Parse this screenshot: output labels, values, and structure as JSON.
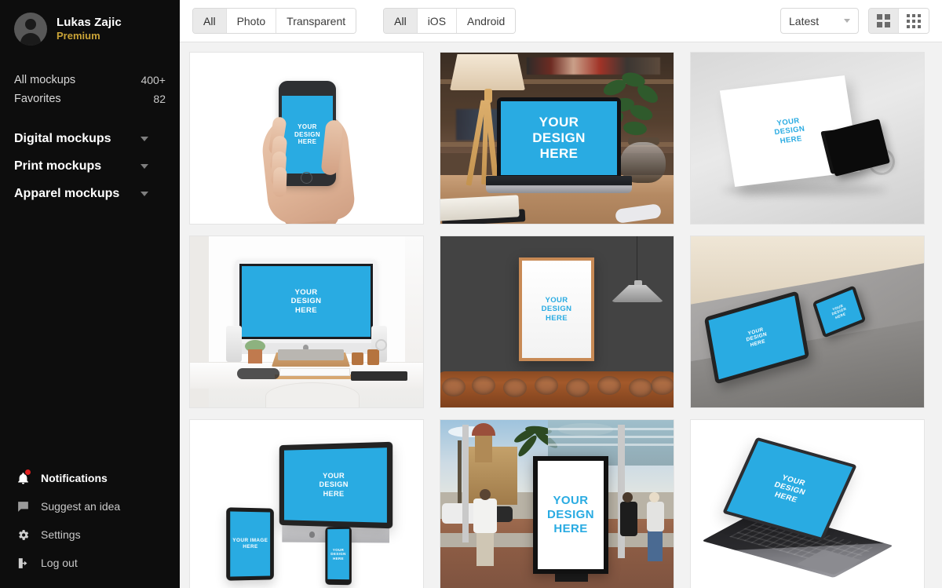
{
  "sidebar": {
    "profile": {
      "name": "Lukas Zajic",
      "plan": "Premium",
      "avatar_icon": "user-avatar-icon"
    },
    "counts": [
      {
        "label": "All mockups",
        "value": "400+"
      },
      {
        "label": "Favorites",
        "value": "82"
      }
    ],
    "groups": [
      {
        "label": "Digital mockups",
        "icon": "chevron-down-icon"
      },
      {
        "label": "Print mockups",
        "icon": "chevron-down-icon"
      },
      {
        "label": "Apparel mockups",
        "icon": "chevron-down-icon"
      }
    ],
    "bottom": [
      {
        "label": "Notifications",
        "icon": "bell-icon",
        "has_badge": true
      },
      {
        "label": "Suggest an idea",
        "icon": "comment-icon",
        "has_badge": false
      },
      {
        "label": "Settings",
        "icon": "gear-icon",
        "has_badge": false
      },
      {
        "label": "Log out",
        "icon": "logout-icon",
        "has_badge": false
      }
    ]
  },
  "toolbar": {
    "type_filter": {
      "options": [
        "All",
        "Photo",
        "Transparent"
      ],
      "selected": "All"
    },
    "platform_filter": {
      "options": [
        "All",
        "iOS",
        "Android"
      ],
      "selected": "All"
    },
    "sort": {
      "value": "Latest",
      "icon": "chevron-down-icon"
    },
    "view": {
      "options": [
        {
          "name": "grid-large-icon",
          "selected": true
        },
        {
          "name": "grid-small-icon",
          "selected": false
        }
      ]
    }
  },
  "gallery": {
    "placeholder_line1": "YOUR",
    "placeholder_line2": "DESIGN",
    "placeholder_line3": "HERE",
    "items": [
      {
        "name": "hand-holding-phone-mockup",
        "caption": "YOUR DESIGN HERE"
      },
      {
        "name": "laptop-on-desk-mockup",
        "caption": "YOUR DESIGN HERE"
      },
      {
        "name": "business-card-clip-mockup",
        "caption": "YOUR DESIGN HERE"
      },
      {
        "name": "imac-workspace-mockup",
        "caption": "YOUR DESIGN HERE"
      },
      {
        "name": "framed-poster-wall-mockup",
        "caption": "YOUR DESIGN HERE"
      },
      {
        "name": "tablet-phone-sofa-mockup",
        "caption": "YOUR DESIGN HERE"
      },
      {
        "name": "multi-device-imac-mockup",
        "caption": "YOUR DESIGN HERE",
        "secondary_caption": "YOUR IMAGE HERE"
      },
      {
        "name": "street-billboard-mockup",
        "caption": "YOUR DESIGN HERE"
      },
      {
        "name": "isometric-macbook-mockup",
        "caption": "YOUR DESIGN HERE"
      }
    ]
  },
  "colors": {
    "sidebar_bg": "#0d0d0d",
    "accent_blue": "#29abe2",
    "premium_gold": "#c9a337",
    "badge_red": "#e02020",
    "content_bg": "#f2f2f2"
  }
}
